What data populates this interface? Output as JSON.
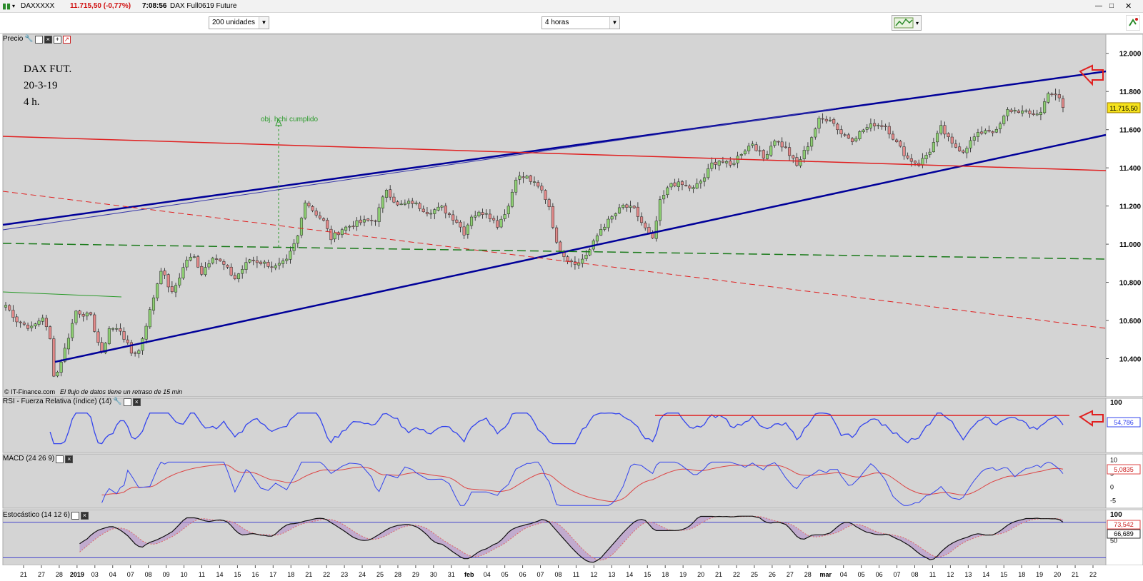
{
  "titlebar": {
    "symbol": "DAXXXXX",
    "price_change": "11.715,50 (-0,77%)",
    "time": "7:08:56",
    "instrument": "DAX Full0619 Future"
  },
  "toolbar": {
    "units_value": "200 unidades",
    "period_value": "4 horas"
  },
  "panels": {
    "price_label": "Precio",
    "rsi_label": "RSI - Fuerza Relativa (índice) (14)",
    "macd_label": "MACD (24 26 9)",
    "stoch_label": "Estocástico (14 12 6)"
  },
  "annotations": {
    "chart_title_1": "DAX FUT.",
    "chart_title_2": "20-3-19",
    "chart_title_3": "4 h.",
    "target_note": "obj. hchi cumplido",
    "source_name": "© IT-Finance.com",
    "source_delay": "El flujo de datos tiene un retraso de 15 min"
  },
  "price_axis": [
    "12.000",
    "11.800",
    "11.600",
    "11.400",
    "11.200",
    "11.000",
    "10.800",
    "10.600",
    "10.400"
  ],
  "current_price": "11.715,50",
  "rsi": {
    "axis": [
      "100"
    ],
    "value": "54,786"
  },
  "macd": {
    "axis": [
      "10",
      "5",
      "0",
      "-5"
    ],
    "value": "5,0835"
  },
  "stoch": {
    "axis": [
      "100",
      "50"
    ],
    "value_1": "73,542",
    "value_2": "66,689"
  },
  "date_axis": [
    "21",
    "27",
    "28",
    "2019",
    "03",
    "04",
    "07",
    "08",
    "09",
    "10",
    "11",
    "14",
    "15",
    "16",
    "17",
    "18",
    "21",
    "22",
    "23",
    "24",
    "25",
    "28",
    "29",
    "30",
    "31",
    "feb",
    "04",
    "05",
    "06",
    "07",
    "08",
    "11",
    "12",
    "13",
    "14",
    "15",
    "18",
    "19",
    "20",
    "21",
    "22",
    "25",
    "26",
    "27",
    "28",
    "mar",
    "04",
    "05",
    "06",
    "07",
    "08",
    "11",
    "12",
    "13",
    "14",
    "15",
    "18",
    "19",
    "20",
    "21",
    "22"
  ],
  "date_axis_bold": [
    "2019",
    "feb",
    "mar"
  ],
  "colors": {
    "bg_chart": "#d4d4d4",
    "channel_blue": "#000099",
    "red_line": "#e02020",
    "green_dashed": "#1a7a1a",
    "up_candle": "#8ecf73",
    "down_candle": "#e28a8a",
    "rsi_line": "#3344ee",
    "price_tag": "#f5e21b"
  },
  "chart_data": {
    "type": "candlestick",
    "price_range": [
      10200,
      12100
    ],
    "close_anchors": [
      [
        0,
        10680
      ],
      [
        3,
        10600
      ],
      [
        7,
        10560
      ],
      [
        10,
        10620
      ],
      [
        12,
        10500
      ],
      [
        13,
        10320
      ],
      [
        14,
        10330
      ],
      [
        16,
        10450
      ],
      [
        19,
        10650
      ],
      [
        23,
        10620
      ],
      [
        26,
        10420
      ],
      [
        28,
        10560
      ],
      [
        31,
        10550
      ],
      [
        34,
        10430
      ],
      [
        36,
        10440
      ],
      [
        39,
        10650
      ],
      [
        42,
        10870
      ],
      [
        45,
        10740
      ],
      [
        49,
        10920
      ],
      [
        51,
        10930
      ],
      [
        53,
        10850
      ],
      [
        56,
        10940
      ],
      [
        59,
        10890
      ],
      [
        62,
        10820
      ],
      [
        66,
        10920
      ],
      [
        70,
        10900
      ],
      [
        73,
        10880
      ],
      [
        76,
        10910
      ],
      [
        79,
        11040
      ],
      [
        81,
        11230
      ],
      [
        83,
        11180
      ],
      [
        86,
        11120
      ],
      [
        88,
        11030
      ],
      [
        91,
        11080
      ],
      [
        95,
        11110
      ],
      [
        100,
        11130
      ],
      [
        103,
        11290
      ],
      [
        106,
        11200
      ],
      [
        110,
        11220
      ],
      [
        114,
        11170
      ],
      [
        118,
        11190
      ],
      [
        122,
        11120
      ],
      [
        124,
        11060
      ],
      [
        126,
        11150
      ],
      [
        130,
        11170
      ],
      [
        133,
        11100
      ],
      [
        136,
        11200
      ],
      [
        138,
        11350
      ],
      [
        141,
        11350
      ],
      [
        145,
        11280
      ],
      [
        147,
        11200
      ],
      [
        149,
        11000
      ],
      [
        152,
        10920
      ],
      [
        155,
        10900
      ],
      [
        158,
        10970
      ],
      [
        161,
        11080
      ],
      [
        164,
        11140
      ],
      [
        167,
        11200
      ],
      [
        170,
        11180
      ],
      [
        173,
        11080
      ],
      [
        175,
        11020
      ],
      [
        177,
        11220
      ],
      [
        180,
        11320
      ],
      [
        183,
        11310
      ],
      [
        186,
        11290
      ],
      [
        189,
        11350
      ],
      [
        191,
        11420
      ],
      [
        193,
        11440
      ],
      [
        196,
        11410
      ],
      [
        199,
        11480
      ],
      [
        202,
        11530
      ],
      [
        205,
        11450
      ],
      [
        208,
        11550
      ],
      [
        211,
        11500
      ],
      [
        214,
        11410
      ],
      [
        217,
        11520
      ],
      [
        220,
        11650
      ],
      [
        223,
        11660
      ],
      [
        226,
        11580
      ],
      [
        229,
        11550
      ],
      [
        232,
        11600
      ],
      [
        235,
        11630
      ],
      [
        238,
        11620
      ],
      [
        241,
        11530
      ],
      [
        244,
        11450
      ],
      [
        247,
        11420
      ],
      [
        250,
        11490
      ],
      [
        253,
        11610
      ],
      [
        256,
        11520
      ],
      [
        259,
        11490
      ],
      [
        262,
        11560
      ],
      [
        265,
        11600
      ],
      [
        268,
        11590
      ],
      [
        271,
        11700
      ],
      [
        274,
        11700
      ],
      [
        277,
        11680
      ],
      [
        280,
        11690
      ],
      [
        282,
        11800
      ],
      [
        285,
        11760
      ],
      [
        286,
        11715
      ]
    ],
    "n_candles": 287,
    "rsi_axis_range": [
      0,
      100
    ],
    "macd_axis_range": [
      -8,
      12
    ],
    "stoch_axis_range": [
      0,
      110
    ]
  }
}
